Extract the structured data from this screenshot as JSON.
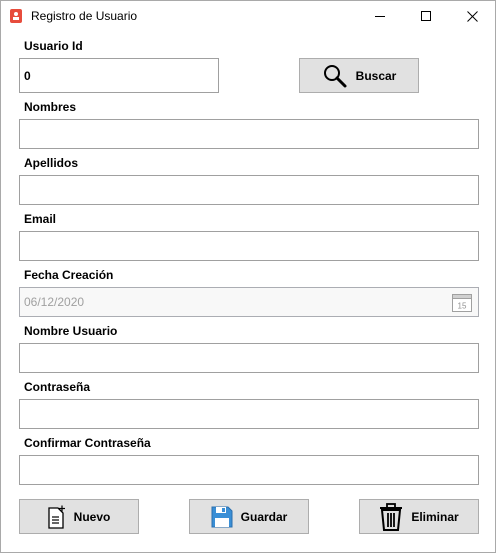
{
  "window": {
    "title": "Registro de Usuario"
  },
  "form": {
    "usuario_id_label": "Usuario Id",
    "usuario_id_value": "0",
    "nombres_label": "Nombres",
    "nombres_value": "",
    "apellidos_label": "Apellidos",
    "apellidos_value": "",
    "email_label": "Email",
    "email_value": "",
    "fecha_label": "Fecha Creación",
    "fecha_value": "06/12/2020",
    "nombre_usuario_label": "Nombre Usuario",
    "nombre_usuario_value": "",
    "contrasena_label": "Contraseña",
    "contrasena_value": "",
    "confirmar_label": "Confirmar Contraseña",
    "confirmar_value": ""
  },
  "buttons": {
    "buscar": "Buscar",
    "nuevo": "Nuevo",
    "guardar": "Guardar",
    "eliminar": "Eliminar"
  },
  "icons": {
    "calendar_day": "15"
  },
  "colors": {
    "app_icon": "#e74c3c",
    "save_icon": "#3a8fd6",
    "button_bg": "#e1e1e1"
  }
}
